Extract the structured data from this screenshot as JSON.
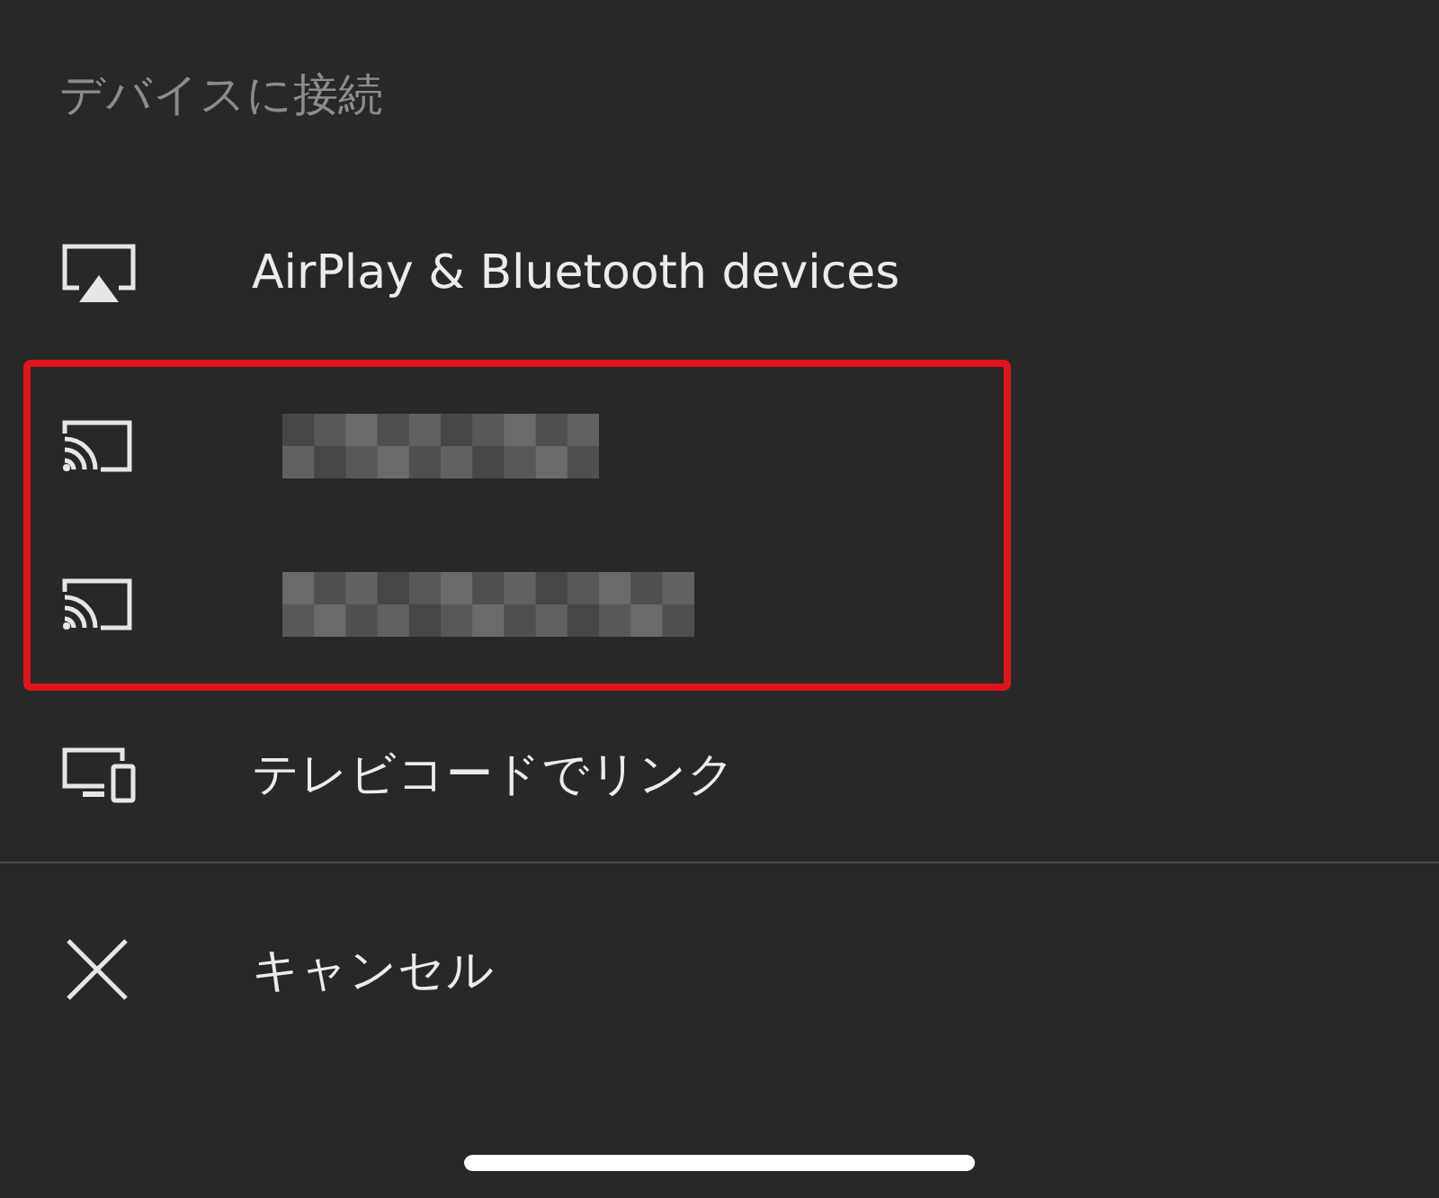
{
  "title": "デバイスに接続",
  "options": [
    {
      "kind": "airplay",
      "label": "AirPlay & Bluetooth devices",
      "highlighted": false
    },
    {
      "kind": "cast",
      "highlighted": true
    },
    {
      "kind": "cast",
      "highlighted": true
    },
    {
      "kind": "tv_code",
      "label": "テレビコードでリンク",
      "highlighted": false
    }
  ],
  "cancel": {
    "label": "キャンセル"
  }
}
